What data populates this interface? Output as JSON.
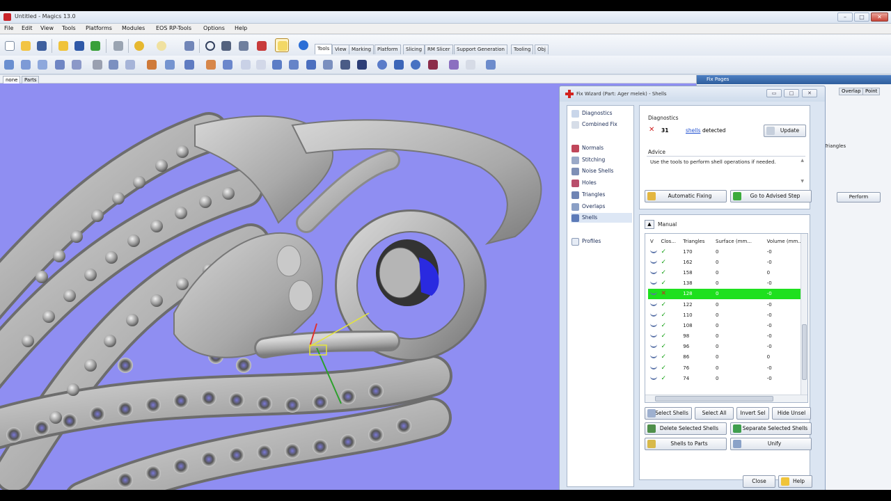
{
  "window": {
    "title": "Untitled - Magics 13.0"
  },
  "menu": [
    "File",
    "Edit",
    "View",
    "Tools",
    "Platforms",
    "Modules",
    "EOS RP-Tools",
    "Options",
    "Help"
  ],
  "ribbon_tabs": [
    "Tools",
    "View",
    "Marking",
    "Platform",
    "Slicing",
    "RM Slicer",
    "Support Generation",
    "Tooling",
    "Obj"
  ],
  "viewport_tabs": [
    "none",
    "Parts"
  ],
  "fix_pages": {
    "title": "Fix Pages",
    "tabs": [
      "Overlap",
      "Point"
    ],
    "label_triangles": "Triangles",
    "perform_button": "Perform"
  },
  "wizard": {
    "title": "Fix Wizard (Part: Ager melek) - Shells",
    "nav": {
      "top": [
        "Diagnostics",
        "Combined Fix"
      ],
      "steps": [
        "Normals",
        "Stitching",
        "Noise Shells",
        "Holes",
        "Triangles",
        "Overlaps",
        "Shells"
      ],
      "selected": "Shells",
      "bottom": [
        "Profiles"
      ]
    },
    "diagnostics": {
      "label": "Diagnostics",
      "count": "31",
      "link": "shells",
      "suffix": "detected",
      "update_button": "Update"
    },
    "advice": {
      "label": "Advice",
      "text": "Use the tools to perform shell operations if needed."
    },
    "actions": {
      "automatic_fixing": "Automatic Fixing",
      "go_to_advised_step": "Go to Advised Step"
    },
    "manual": {
      "label": "Manual",
      "columns": [
        "V",
        "Clos...",
        "Triangles",
        "Surface (mm...",
        "Volume (mm..."
      ],
      "rows": [
        {
          "closed": "ok",
          "triangles": "170",
          "surface": "0",
          "volume": "-0",
          "selected": false
        },
        {
          "closed": "ok",
          "triangles": "162",
          "surface": "0",
          "volume": "-0",
          "selected": false
        },
        {
          "closed": "ok",
          "triangles": "158",
          "surface": "0",
          "volume": "0",
          "selected": false
        },
        {
          "closed": "ok",
          "triangles": "138",
          "surface": "0",
          "volume": "-0",
          "selected": false
        },
        {
          "closed": "bad",
          "triangles": "128",
          "surface": "0",
          "volume": "-0",
          "selected": true
        },
        {
          "closed": "ok",
          "triangles": "122",
          "surface": "0",
          "volume": "-0",
          "selected": false
        },
        {
          "closed": "ok",
          "triangles": "110",
          "surface": "0",
          "volume": "-0",
          "selected": false
        },
        {
          "closed": "ok",
          "triangles": "108",
          "surface": "0",
          "volume": "-0",
          "selected": false
        },
        {
          "closed": "ok",
          "triangles": "98",
          "surface": "0",
          "volume": "-0",
          "selected": false
        },
        {
          "closed": "ok",
          "triangles": "96",
          "surface": "0",
          "volume": "-0",
          "selected": false
        },
        {
          "closed": "ok",
          "triangles": "86",
          "surface": "0",
          "volume": "0",
          "selected": false
        },
        {
          "closed": "ok",
          "triangles": "76",
          "surface": "0",
          "volume": "-0",
          "selected": false
        },
        {
          "closed": "ok",
          "triangles": "74",
          "surface": "0",
          "volume": "-0",
          "selected": false
        }
      ]
    },
    "buttons": {
      "select_shells": "Select Shells",
      "select_all": "Select All",
      "invert_sel": "Invert Sel",
      "hide_unsel": "Hide Unsel",
      "delete_selected_shells": "Delete Selected Shells",
      "separate_selected_shells": "Separate Selected Shells",
      "shells_to_parts": "Shells to Parts",
      "unify": "Unify",
      "close": "Close",
      "help": "Help"
    }
  },
  "colors": {
    "viewport_bg": "#8f8ef2",
    "selection_green": "#1ee01e",
    "model_gray": "#b4b4b4"
  }
}
